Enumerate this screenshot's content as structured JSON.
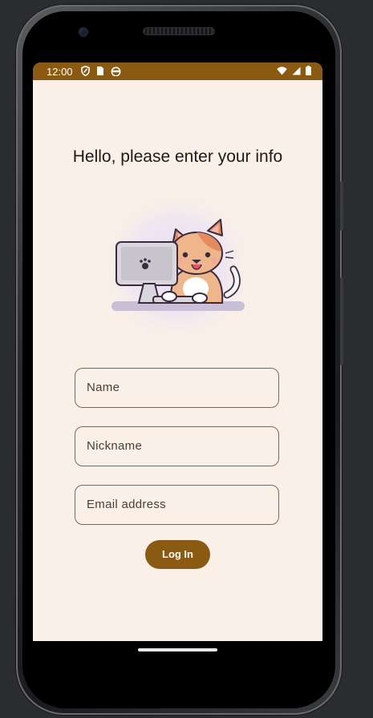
{
  "status_bar": {
    "time": "12:00",
    "left_icons": [
      "shield-icon",
      "sim-card-icon",
      "cat-face-icon"
    ],
    "right_icons": [
      "wifi-icon",
      "signal-icon",
      "battery-icon"
    ],
    "color": "#8a5a12"
  },
  "main": {
    "title": "Hello, please enter your info",
    "illustration": "cat-at-computer-illustration",
    "fields": {
      "name_placeholder": "Name",
      "nickname_placeholder": "Nickname",
      "email_placeholder": "Email address"
    },
    "login_label": "Log In"
  },
  "colors": {
    "background": "#faf0e8",
    "accent": "#8a5a12",
    "field_border": "#7a6a5c"
  }
}
